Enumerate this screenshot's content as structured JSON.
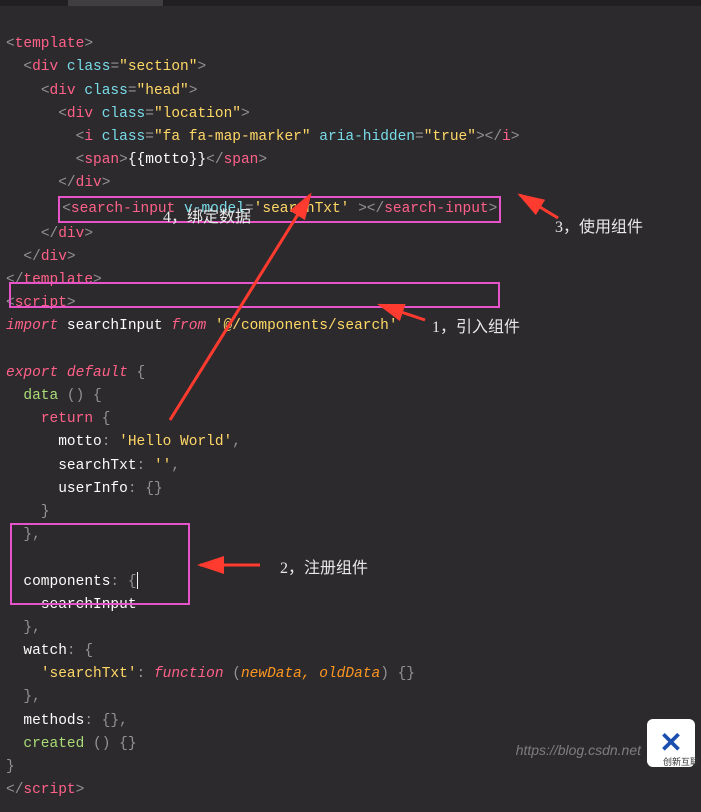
{
  "code": {
    "l1": {
      "tag": "template"
    },
    "l2": {
      "tag": "div",
      "attr": "class",
      "val": "\"section\""
    },
    "l3": {
      "tag": "div",
      "attr": "class",
      "val": "\"head\""
    },
    "l4": {
      "tag": "div",
      "attr": "class",
      "val": "\"location\""
    },
    "l5": {
      "tag": "i",
      "attr1": "class",
      "val1": "\"fa fa-map-marker\"",
      "attr2": "aria-hidden",
      "val2": "\"true\"",
      "close": "i"
    },
    "l6": {
      "tag": "span",
      "content": "{{motto}}",
      "close": "span"
    },
    "l7": {
      "close": "div"
    },
    "l8": {
      "tag": "search-input",
      "attr": "v-model",
      "val": "'searchTxt'",
      "close": "search-input"
    },
    "l9": {
      "close": "div"
    },
    "l10": {
      "close": "div"
    },
    "l11": {
      "close": "template"
    },
    "l12": {
      "tag": "script"
    },
    "l13": {
      "kw1": "import",
      "id": "searchInput",
      "kw2": "from",
      "str": "'@/components/search'"
    },
    "l14": {
      "kw": "export default",
      "brace": "{"
    },
    "l15": {
      "fn": "data",
      "paren": "()",
      "brace": "{"
    },
    "l16": {
      "kw": "return",
      "brace": "{"
    },
    "l17": {
      "key": "motto",
      "val": "'Hello World'",
      "comma": ","
    },
    "l18": {
      "key": "searchTxt",
      "val": "''",
      "comma": ","
    },
    "l19": {
      "key": "userInfo",
      "val": "{}"
    },
    "l20": {
      "brace": "}"
    },
    "l21": {
      "brace": "},"
    },
    "l22": {
      "key": "components",
      "brace": "{"
    },
    "l23": {
      "id": "searchInput"
    },
    "l24": {
      "brace": "},"
    },
    "l25": {
      "key": "watch",
      "brace": "{"
    },
    "l26": {
      "key": "'searchTxt'",
      "fn": "function",
      "params": "newData, oldData",
      "body": "{}"
    },
    "l27": {
      "brace": "},"
    },
    "l28": {
      "key": "methods",
      "val": "{},"
    },
    "l29": {
      "fn": "created",
      "paren": "()",
      "body": "{}"
    },
    "l30": {
      "brace": "}"
    },
    "l31": {
      "close": "script"
    }
  },
  "annotations": {
    "a1": "1，引入组件",
    "a2": "2，注册组件",
    "a3": "3，使用组件",
    "a4": "4，绑定数据"
  },
  "watermark": "https://blog.csdn.net",
  "logo": "创新互联"
}
